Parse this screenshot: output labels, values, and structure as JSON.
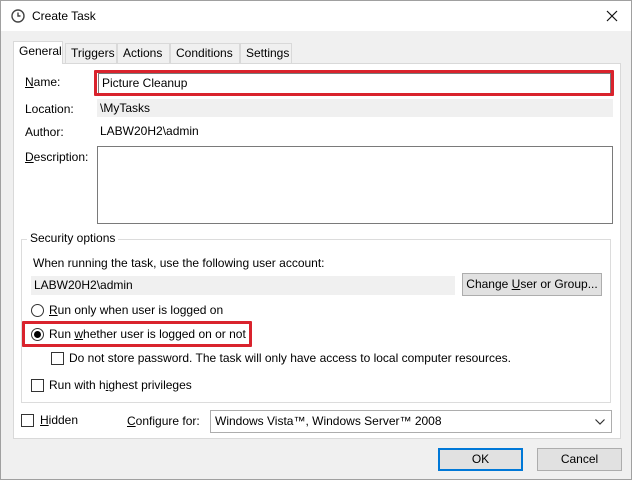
{
  "window": {
    "title": "Create Task"
  },
  "tabs": [
    {
      "label": "General",
      "active": true
    },
    {
      "label": "Triggers",
      "active": false
    },
    {
      "label": "Actions",
      "active": false
    },
    {
      "label": "Conditions",
      "active": false
    },
    {
      "label": "Settings",
      "active": false
    }
  ],
  "general": {
    "name_label": "Name:",
    "name_value": "Picture Cleanup",
    "location_label": "Location:",
    "location_value": "\\MyTasks",
    "author_label": "Author:",
    "author_value": "LABW20H2\\admin",
    "description_label": "Description:",
    "description_value": ""
  },
  "security": {
    "group_label": "Security options",
    "account_prompt": "When running the task, use the following user account:",
    "account_value": "LABW20H2\\admin",
    "change_user_button": "Change User or Group...",
    "radio_logged_on_only": "Run only when user is logged on",
    "radio_whether_logged_on": "Run whether user is logged on or not",
    "selected_radio": "radio_whether_logged_on",
    "no_store_password": "Do not store password.  The task will only have access to local computer resources.",
    "highest_privileges": "Run with highest privileges"
  },
  "bottom": {
    "hidden_label": "Hidden",
    "configure_label": "Configure for:",
    "configure_value": "Windows Vista™, Windows Server™ 2008",
    "ok_button": "OK",
    "cancel_button": "Cancel"
  },
  "colors": {
    "highlight": "#d9232d",
    "primary_border": "#0078d7"
  }
}
